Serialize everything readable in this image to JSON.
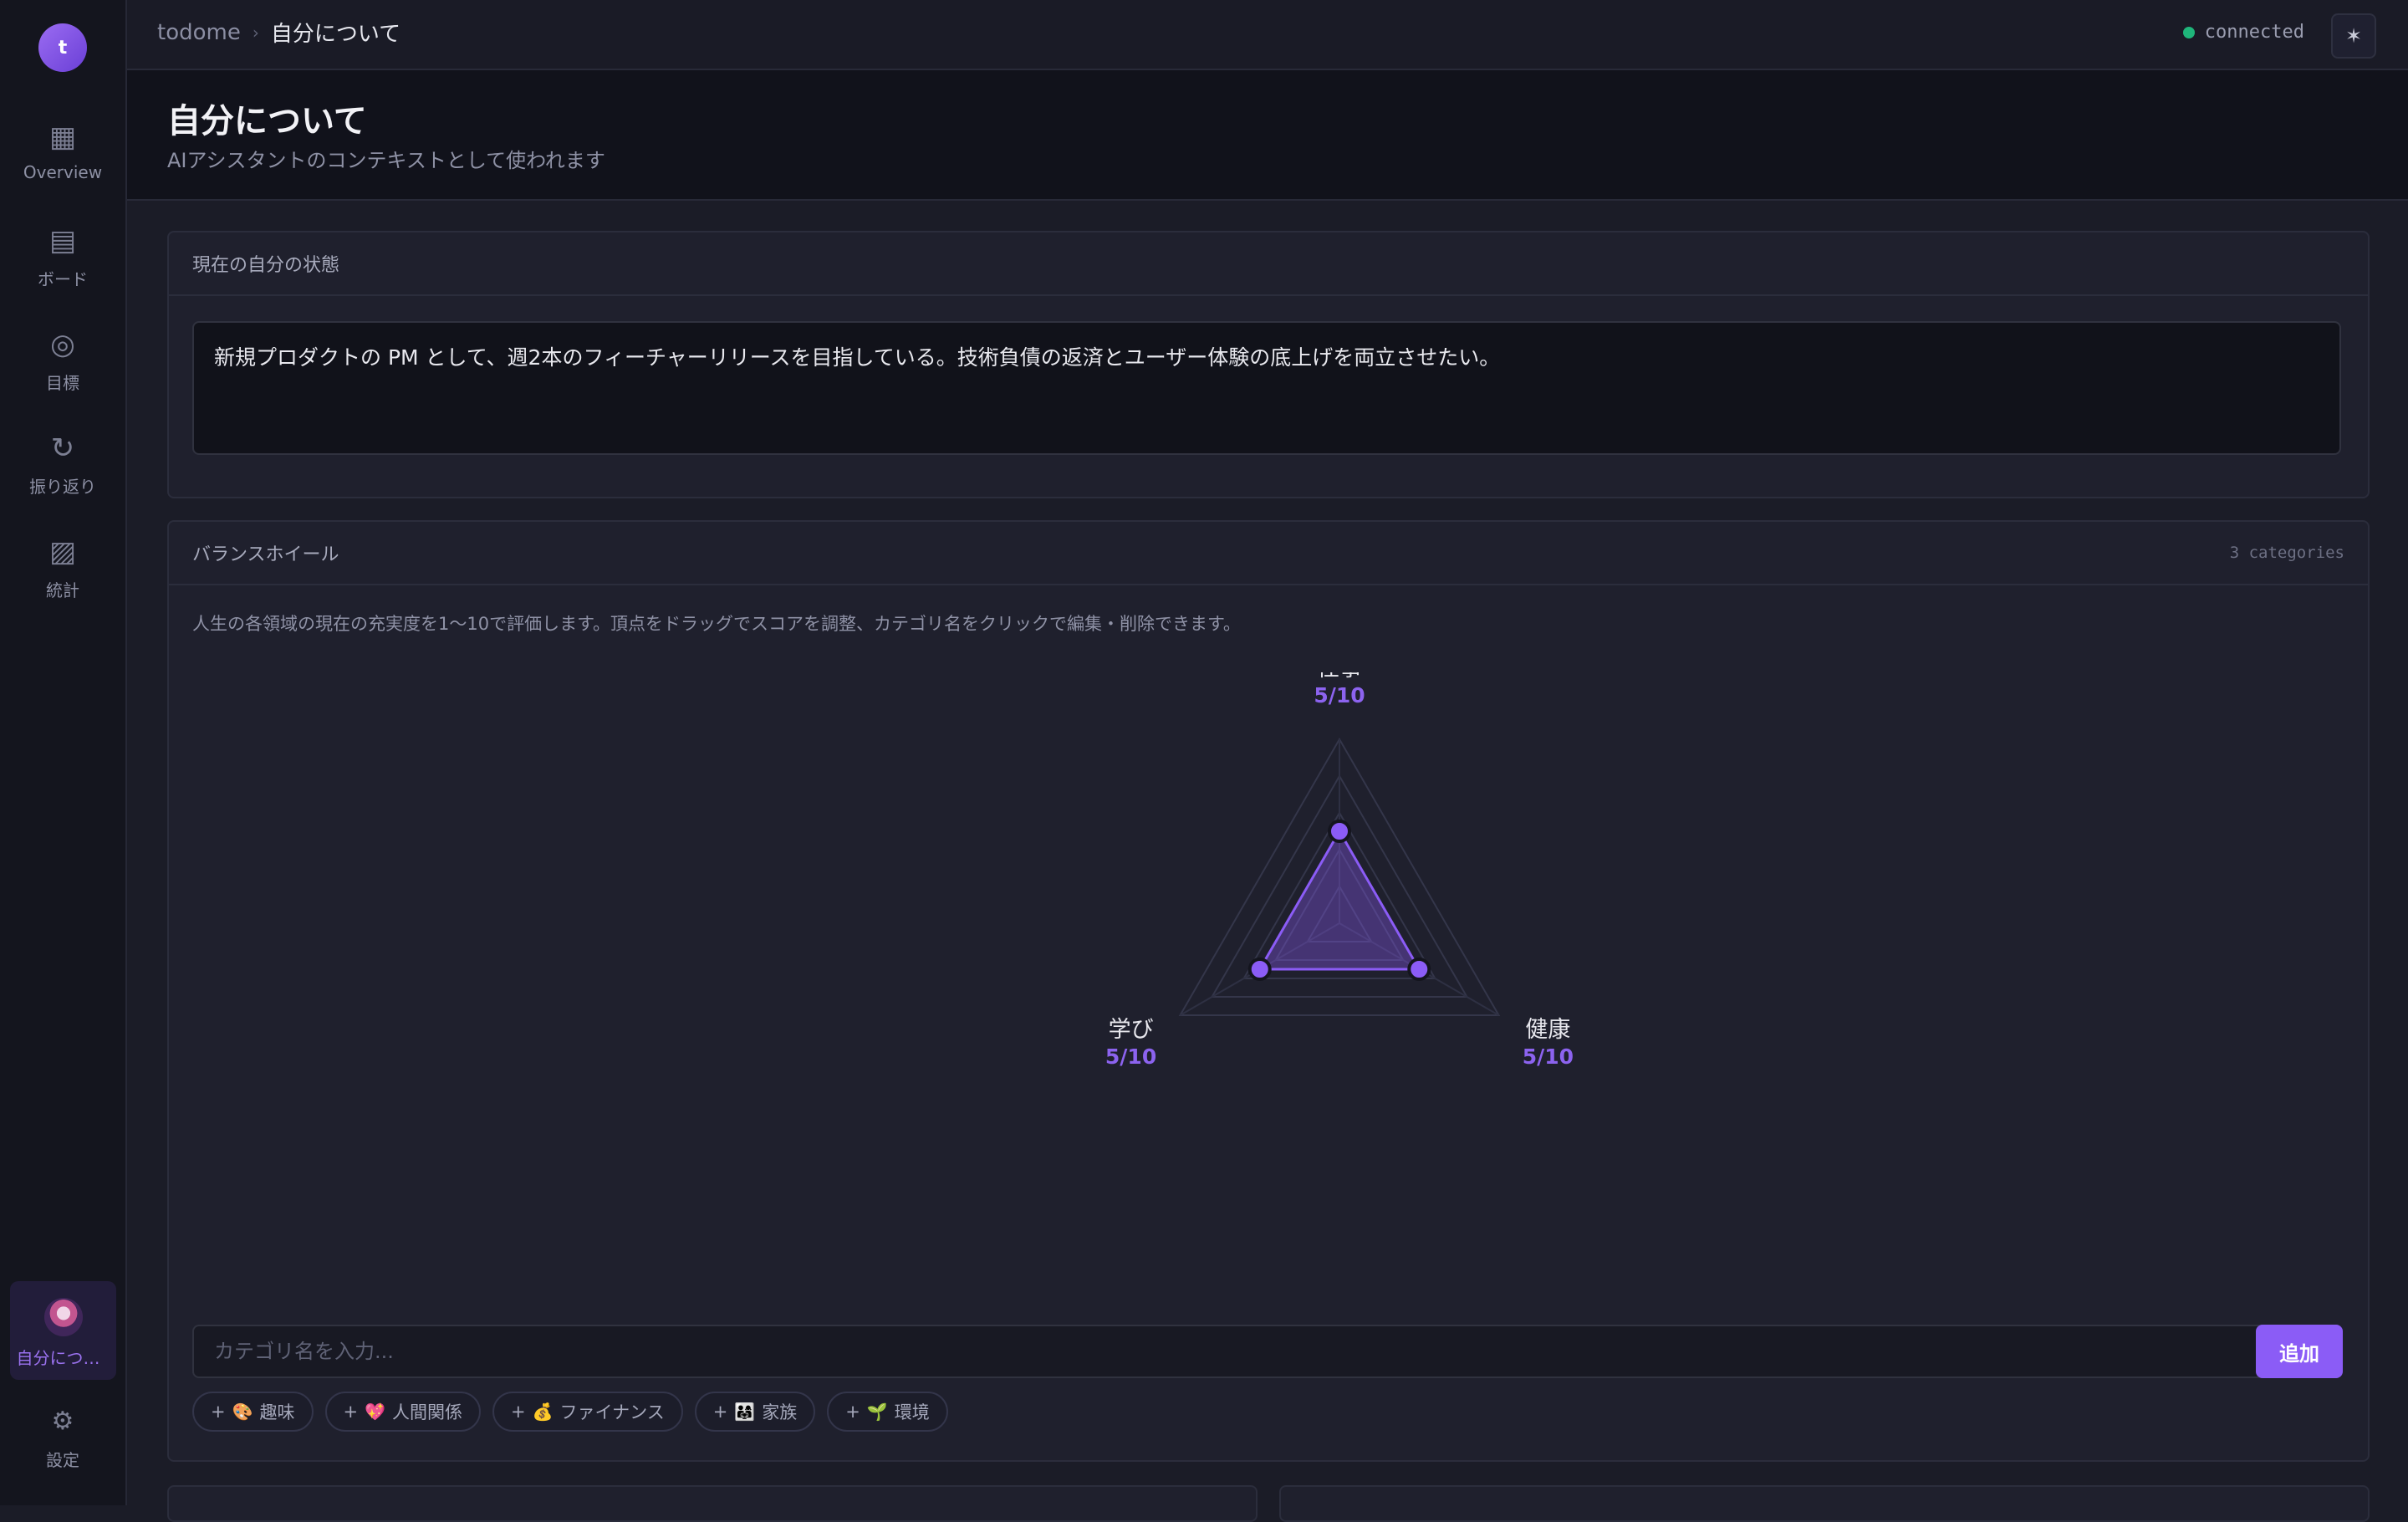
{
  "app": {
    "avatar_letter": "t"
  },
  "sidebar": {
    "items": [
      {
        "label": "Overview",
        "icon": "▦",
        "icon_name": "overview-icon"
      },
      {
        "label": "ボード",
        "icon": "▤",
        "icon_name": "board-icon"
      },
      {
        "label": "目標",
        "icon": "◎",
        "icon_name": "target-icon"
      },
      {
        "label": "振り返り",
        "icon": "↻",
        "icon_name": "refresh-icon"
      },
      {
        "label": "統計",
        "icon": "▨",
        "icon_name": "stats-icon"
      }
    ],
    "active_label": "自分につい...",
    "settings": {
      "label": "設定",
      "icon": "⚙"
    }
  },
  "topbar": {
    "breadcrumb_root": "todome",
    "breadcrumb_sep": "›",
    "breadcrumb_current": "自分について",
    "status": "connected",
    "theme_icon": "✶"
  },
  "header": {
    "title": "自分について",
    "subtitle": "AIアシスタントのコンテキストとして使われます"
  },
  "state_card": {
    "title": "現在の自分の状態",
    "text": "新規プロダクトの PM として、週2本のフィーチャーリリースを目指している。技術負債の返済とユーザー体験の底上げを両立させたい。"
  },
  "wheel_card": {
    "title": "バランスホイール",
    "meta": "3 categories",
    "description": "人生の各領域の現在の充実度を1〜10で評価します。頂点をドラッグでスコアを調整、カテゴリ名をクリックで編集・削除できます。",
    "categories": [
      {
        "name": "仕事",
        "score": 5,
        "score_label": "5/10"
      },
      {
        "name": "健康",
        "score": 5,
        "score_label": "5/10"
      },
      {
        "name": "学び",
        "score": 5,
        "score_label": "5/10"
      }
    ],
    "max_score": 10,
    "input_placeholder": "カテゴリ名を入力...",
    "add_label": "追加",
    "suggestions": [
      {
        "emoji": "🎨",
        "label": "趣味"
      },
      {
        "emoji": "💖",
        "label": "人間関係"
      },
      {
        "emoji": "💰",
        "label": "ファイナンス"
      },
      {
        "emoji": "👨‍👩‍👧",
        "label": "家族"
      },
      {
        "emoji": "🌱",
        "label": "環境"
      }
    ]
  },
  "colors": {
    "accent": "#8b5cf6",
    "status_ok": "#1fb57a"
  }
}
